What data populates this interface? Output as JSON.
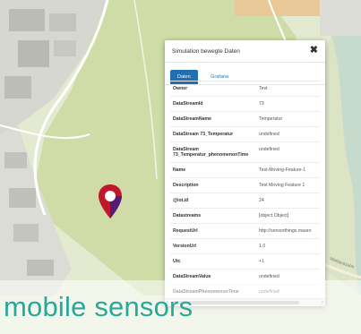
{
  "panel": {
    "title": "Simulation bewegte Daten",
    "close_symbol": "✖",
    "tabs": [
      "Daten",
      "Grafana"
    ],
    "rows": [
      {
        "key": "Owner",
        "value": "Test"
      },
      {
        "key": "DataStreamId",
        "value": "73"
      },
      {
        "key": "DataStreamName",
        "value": "Temperatur"
      },
      {
        "key": "DataStream 73_Temperatur",
        "value": "undefined"
      },
      {
        "key": "DataStream 73_Temperatur_phenomenonTime",
        "value": "undefined"
      },
      {
        "key": "Name",
        "value": "Test-Moving-Feature-1"
      },
      {
        "key": "Description",
        "value": "Test Moving Feature 1"
      },
      {
        "key": "@iot.id",
        "value": "24"
      },
      {
        "key": "Datastreams",
        "value": "[object Object]"
      },
      {
        "key": "RequestUrl",
        "value": "http://sensorthings.maaro"
      },
      {
        "key": "VersionUrl",
        "value": "1.0"
      },
      {
        "key": "Utc",
        "value": "+1"
      },
      {
        "key": "DataStreamValue",
        "value": "undefined"
      },
      {
        "key": "DataStreamPhenomenonTime",
        "value": "undefined"
      }
    ]
  },
  "map_labels": {
    "street": "Mattauszahn"
  },
  "caption": "mobile sensors",
  "colors": {
    "accent": "#1f6fb4",
    "caption": "#26a99a",
    "marker": "#c0182b"
  }
}
